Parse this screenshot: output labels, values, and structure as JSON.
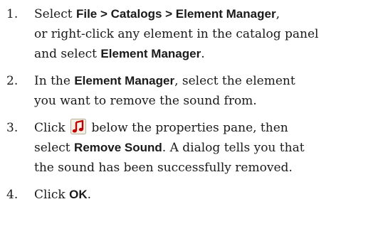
{
  "steps": [
    {
      "number": "1.",
      "t1": "Select ",
      "b1": "File > Catalogs > Element Manager",
      "t2": ",",
      "t3": "or right-click any element in the catalog panel",
      "t4": "and select ",
      "b2": "Element Manager",
      "t5": "."
    },
    {
      "number": "2.",
      "t1": "In the ",
      "b1": "Element Manager",
      "t2": ", select the element",
      "t3": "you want to remove the sound from."
    },
    {
      "number": "3.",
      "t1": "Click ",
      "icon": "music-note-sound-icon",
      "t2": " below the properties pane, then",
      "t3": "select ",
      "b1": "Remove Sound",
      "t4": ". A dialog tells you that",
      "t5": "the sound has been successfully removed."
    },
    {
      "number": "4.",
      "t1": "Click ",
      "b1": "OK",
      "t2": "."
    }
  ],
  "colors": {
    "text": "#1a1a1a",
    "icon_note": "#c00000",
    "icon_bg": "#f5f0e6"
  }
}
